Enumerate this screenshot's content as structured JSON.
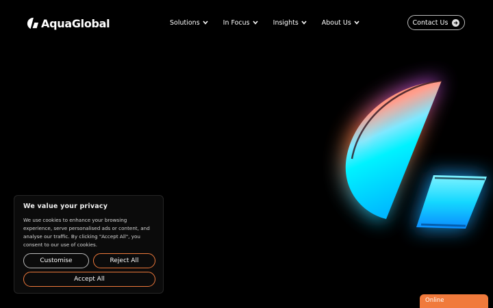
{
  "brand": {
    "name": "AquaGlobal",
    "logo_icon": "aqua-logo-icon",
    "accent_color": "#f07a3c"
  },
  "nav": {
    "items": [
      {
        "label": "Solutions"
      },
      {
        "label": "In Focus"
      },
      {
        "label": "Insights"
      },
      {
        "label": "About Us"
      }
    ],
    "contact_label": "Contact Us"
  },
  "cookie": {
    "title": "We value your privacy",
    "body": "We use cookies to enhance your browsing experience, serve personalised ads or content, and analyse our traffic. By clicking \"Accept All\", you consent to our use of cookies.",
    "customise_label": "Customise",
    "reject_label": "Reject All",
    "accept_label": "Accept All"
  },
  "chat": {
    "status_label": "Online"
  }
}
